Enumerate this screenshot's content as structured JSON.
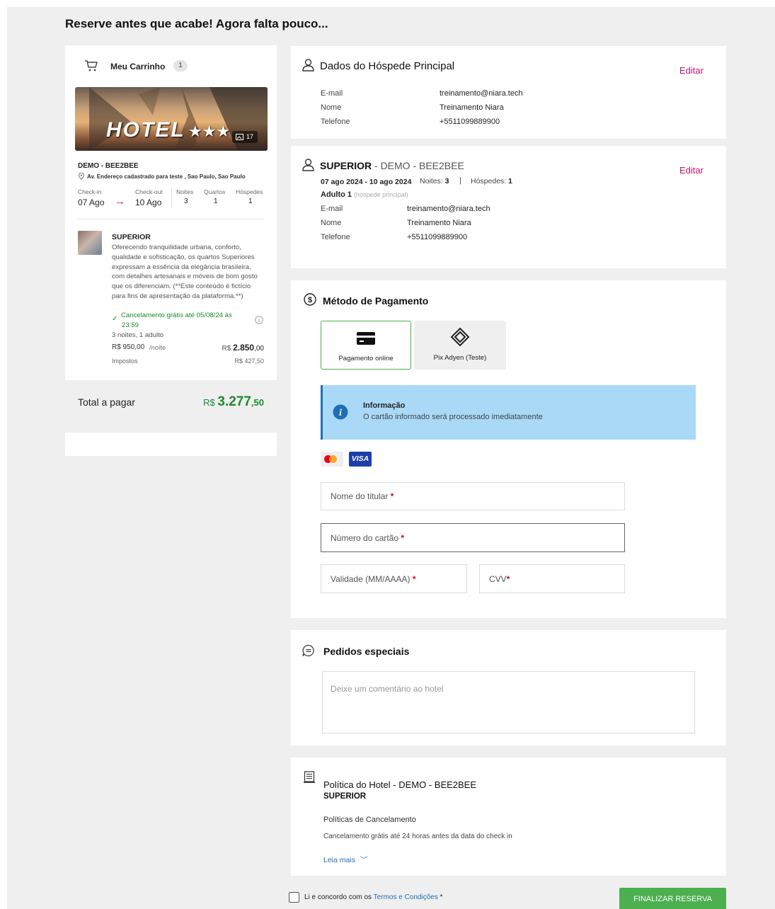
{
  "page": {
    "heading": "Reserve antes que acabe! Agora falta pouco..."
  },
  "cart": {
    "title": "Meu Carrinho",
    "count": "1",
    "image_text": "HOTEL",
    "photo_count": "17",
    "hotel_name": "DEMO - BEE2BEE",
    "address": "Av. Endereço cadastrado para teste , Sao Paulo, Sao Paulo",
    "checkin_label": "Check-in",
    "checkin_value": "07 Ago",
    "checkout_label": "Check-out",
    "checkout_value": "10 Ago",
    "nights_label": "Noites",
    "nights_value": "3",
    "rooms_label": "Quartos",
    "rooms_value": "1",
    "guests_label": "Hóspedes",
    "guests_value": "1",
    "room": {
      "name": "SUPERIOR",
      "description": "Oferecendo tranquilidade urbana, conforto, qualidade e sofisticação, os quartos Superiores expressam a essência da elegância brasileira, com detalhes artesanais e móveis de bom gosto que os diferenciam. (**Este conteúdo é fictício para fins de apresentação da plataforma.**)",
      "cancel_line1": "Cancelamento grátis até 05/08/24 às",
      "cancel_line2": "23:59",
      "summary": "3 noites, 1 adulto",
      "price_per_night": "R$ 950,00",
      "per_night_label": "/noite",
      "subtotal_prefix": "R$",
      "subtotal_main": "2.850",
      "subtotal_cents": ",00",
      "taxes_label": "Impostos",
      "taxes_value": "R$ 427,50"
    },
    "total_label": "Total a pagar",
    "total_prefix": "R$",
    "total_main": "3.277",
    "total_cents": ",50"
  },
  "main_guest": {
    "title": "Dados do Hóspede Principal",
    "edit": "Editar",
    "rows": [
      {
        "label": "E-mail",
        "value": "treinamento@niara.tech"
      },
      {
        "label": "Nome",
        "value": "Treinamento Niara"
      },
      {
        "label": "Telefone",
        "value": "+5511099889900"
      }
    ]
  },
  "room_guest": {
    "title_bold": "SUPERIOR",
    "title_rest": " - DEMO - BEE2BEE",
    "edit": "Editar",
    "dates": "07 ago 2024 - 10 ago 2024",
    "nights_label": "Noites:",
    "nights_value": "3",
    "separator": "|",
    "guests_label": "Hóspedes:",
    "guests_value": "1",
    "adult": "Adulto 1",
    "adult_note": "(hóspede principal)",
    "rows": [
      {
        "label": "E-mail",
        "value": "treinamento@niara.tech"
      },
      {
        "label": "Nome",
        "value": "Treinamento Niara"
      },
      {
        "label": "Telefone",
        "value": "+5511099889900"
      }
    ]
  },
  "payment": {
    "title": "Método de Pagamento",
    "options": [
      {
        "label": "Pagamento online"
      },
      {
        "label": "Pix Adyen (Teste)"
      }
    ],
    "info_title": "Informação",
    "info_text": "O cartão informado será processado imediatamente",
    "visa_label": "VISA",
    "fields": {
      "holder": "Nome do titular",
      "card_number": "Número do cartão",
      "validity": "Validade (MM/AAAA)",
      "cvv": "CVV",
      "required": "*"
    }
  },
  "special": {
    "title": "Pedidos especiais",
    "placeholder": "Deixe um comentário ao hotel"
  },
  "policy": {
    "title": "Política do Hotel - DEMO - BEE2BEE",
    "subtitle": "SUPERIOR",
    "section": "Políticas de Cancelamento",
    "text": "Cancelamento grátis até 24 horas antes da data do check in",
    "read_more": "Leia mais"
  },
  "footer": {
    "agree_prefix": "Li e concordo com os",
    "terms_link": "Termos e Condições",
    "required": "*",
    "submit": "FINALIZAR RESERVA"
  },
  "colors": {
    "accent_green": "#1e8a2e",
    "edit_pink": "#c0176e",
    "info_bg": "#a9d9f7",
    "submit_green": "#4caf50"
  }
}
